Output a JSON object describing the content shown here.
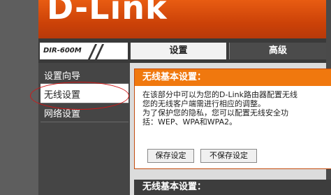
{
  "brand": {
    "logo": "D-Link",
    "model": "DIR-600M"
  },
  "tabs": [
    {
      "label": "设置",
      "active": true
    },
    {
      "label": "高级",
      "active": false
    }
  ],
  "sidebar": {
    "items": [
      {
        "label": "设置向导",
        "active": false
      },
      {
        "label": "无线设置",
        "active": true
      },
      {
        "label": "网络设置",
        "active": false
      }
    ]
  },
  "panel": {
    "title": "无线基本设置：",
    "lines": [
      "在该部分中可以为您的D-Link路由器配置无线",
      "您的无线客户端需进行相应的调整。",
      "为了保护您的隐私，您可以配置无线安全功",
      "括：WEP、WPA和WPA2。"
    ],
    "save_label": "保存设定",
    "nosave_label": "不保存设定"
  },
  "section2": {
    "title": "无线基本设置："
  },
  "colors": {
    "brand_orange": "#e85c12",
    "header_orange": "#f0780e",
    "highlight_red": "#d01818"
  }
}
